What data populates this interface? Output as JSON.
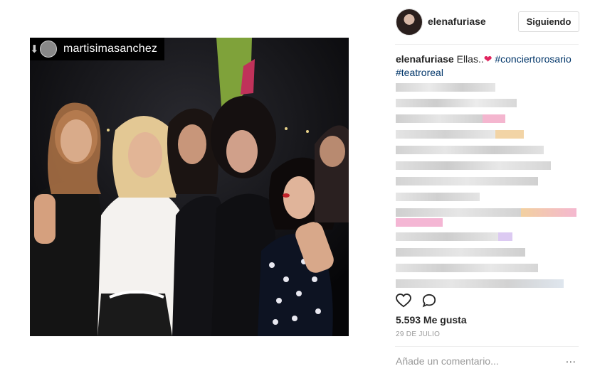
{
  "photo": {
    "regram_username": "martisimasanchez"
  },
  "header": {
    "username": "elenafuriase",
    "follow_label": "Siguiendo"
  },
  "caption": {
    "username": "elenafuriase",
    "text": "Ellas..",
    "emoji": "❤",
    "hashtags": [
      "#conciertorosario",
      "#teatroreal"
    ]
  },
  "comments_blurred": true,
  "actions": {
    "like_icon": "heart-outline-icon",
    "comment_icon": "speech-bubble-icon"
  },
  "likes": "5.593 Me gusta",
  "date": "29 DE JULIO",
  "add_comment_placeholder": "Añade un comentario...",
  "more_options": "...",
  "colors": {
    "link": "#003569",
    "muted": "#999999",
    "border": "#dbdbdb"
  }
}
